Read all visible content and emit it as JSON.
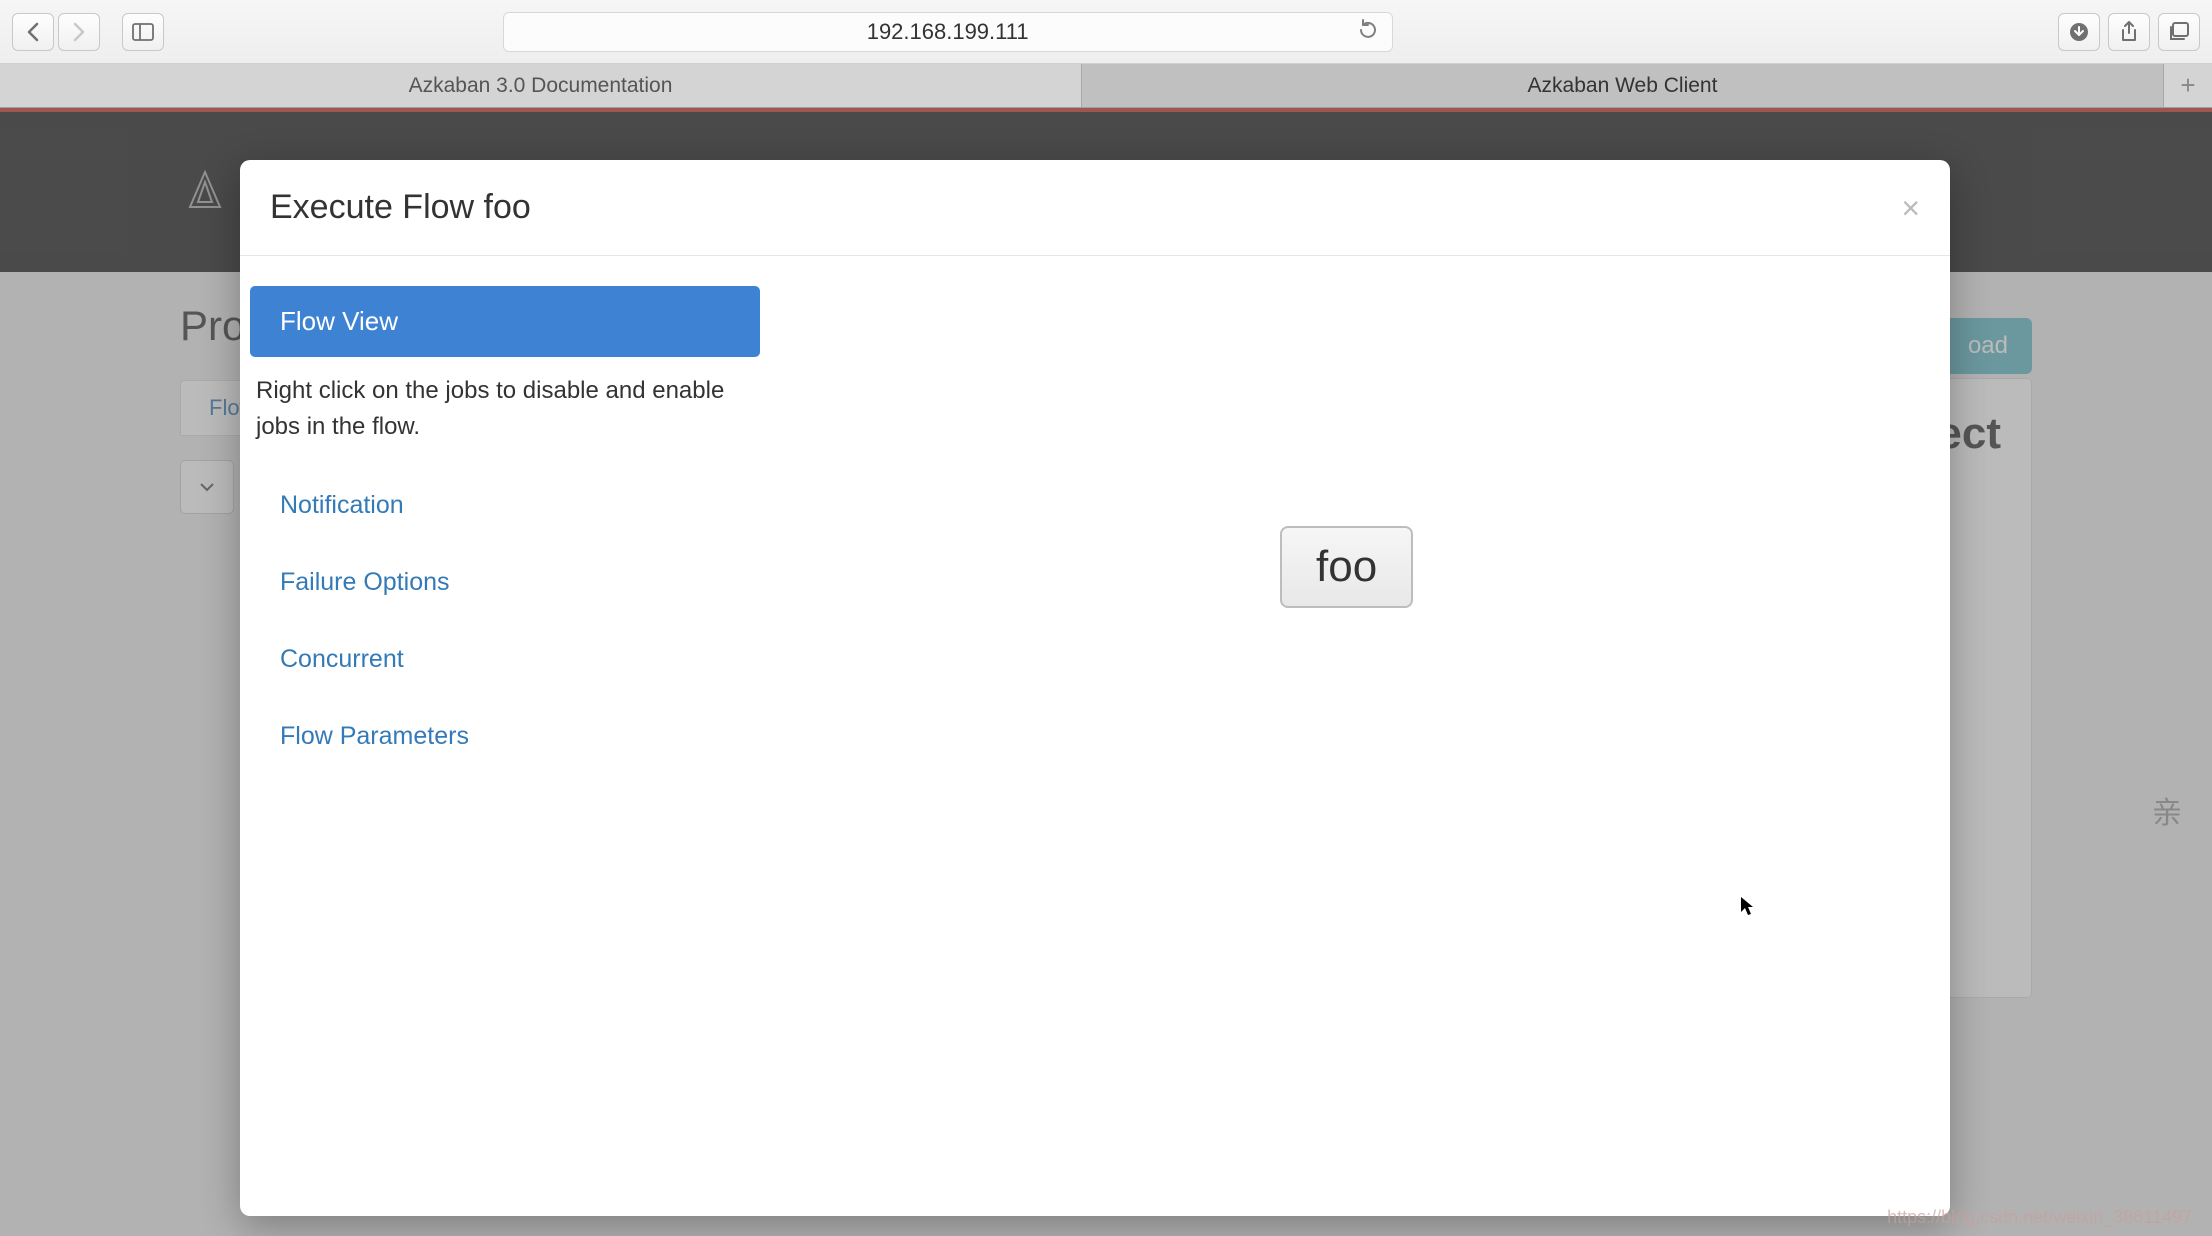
{
  "browser": {
    "address": "192.168.199.111",
    "tabs": [
      {
        "label": "Azkaban 3.0 Documentation",
        "active": false
      },
      {
        "label": "Azkaban Web Client",
        "active": true
      }
    ]
  },
  "page": {
    "title": "Pro",
    "upload_label": "oad",
    "content_tab": "Flow",
    "side_panel_title": "ect"
  },
  "modal": {
    "title": "Execute Flow foo",
    "close_glyph": "×",
    "sidebar": {
      "active": "Flow View",
      "hint": "Right click on the jobs to disable and enable jobs in the flow.",
      "items": [
        "Notification",
        "Failure Options",
        "Concurrent",
        "Flow Parameters"
      ]
    },
    "job_node": "foo"
  },
  "watermark": {
    "right": "亲",
    "bottom": "https://blog.csdn.net/weixin_38611497"
  }
}
